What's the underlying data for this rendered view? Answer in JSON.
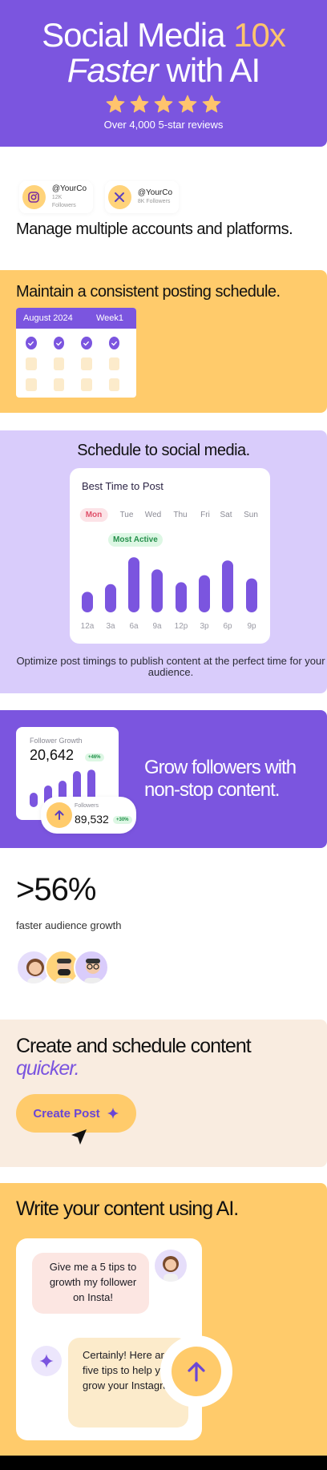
{
  "hero": {
    "title_part1": "Social Media ",
    "title_accent": "10x",
    "title_italic": "Faster",
    "title_part2": " with AI",
    "reviews": "Over 4,000 5-star reviews",
    "star_icon": "star-icon",
    "star_color": "#FFC46D",
    "bg_color": "#7B55DF"
  },
  "accounts": {
    "items": [
      {
        "icon": "instagram-icon",
        "handle": "@YourCo",
        "followers": "12K Followers"
      },
      {
        "icon": "x-logo-icon",
        "handle": "@YourCo",
        "followers": "8K Followers"
      }
    ],
    "headline": "Manage multiple accounts and platforms."
  },
  "schedule": {
    "headline": "Maintain a consistent posting schedule.",
    "month": "August 2024",
    "week": "Week1"
  },
  "best_time": {
    "section_title": "Schedule to social media.",
    "card_title": "Best Time to Post",
    "days": [
      "Mon",
      "Tue",
      "Wed",
      "Thu",
      "Fri",
      "Sat",
      "Sun"
    ],
    "active_day": "Mon",
    "badge": "Most Active",
    "hours": [
      "12a",
      "3a",
      "6a",
      "9a",
      "12p",
      "3p",
      "6p",
      "9p"
    ],
    "activity_values": [
      0.32,
      0.44,
      0.86,
      0.67,
      0.47,
      0.58,
      0.81,
      0.53
    ],
    "caption": "Optimize post timings to publish content at the perfect time for your audience.",
    "bar_color": "#7B55DF"
  },
  "grow": {
    "card_title": "Follower Growth",
    "value": "20,642",
    "badge": "+46%",
    "bars": [
      0.3,
      0.45,
      0.55,
      0.75,
      0.78
    ],
    "followers_label": "Followers",
    "followers_value": "89,532",
    "followers_badge": "+30%",
    "headline": "Grow followers with non-stop content."
  },
  "stat": {
    "value": ">56%",
    "label": "faster audience growth"
  },
  "create": {
    "headline": "Create and schedule content",
    "headline_accent": "quicker.",
    "button": "Create Post"
  },
  "write": {
    "headline": "Write your content using AI.",
    "user_message": "Give me a 5 tips to growth my follower on Insta!",
    "ai_message": "Certainly! Here are five tips to help you grow your Instagram..."
  }
}
